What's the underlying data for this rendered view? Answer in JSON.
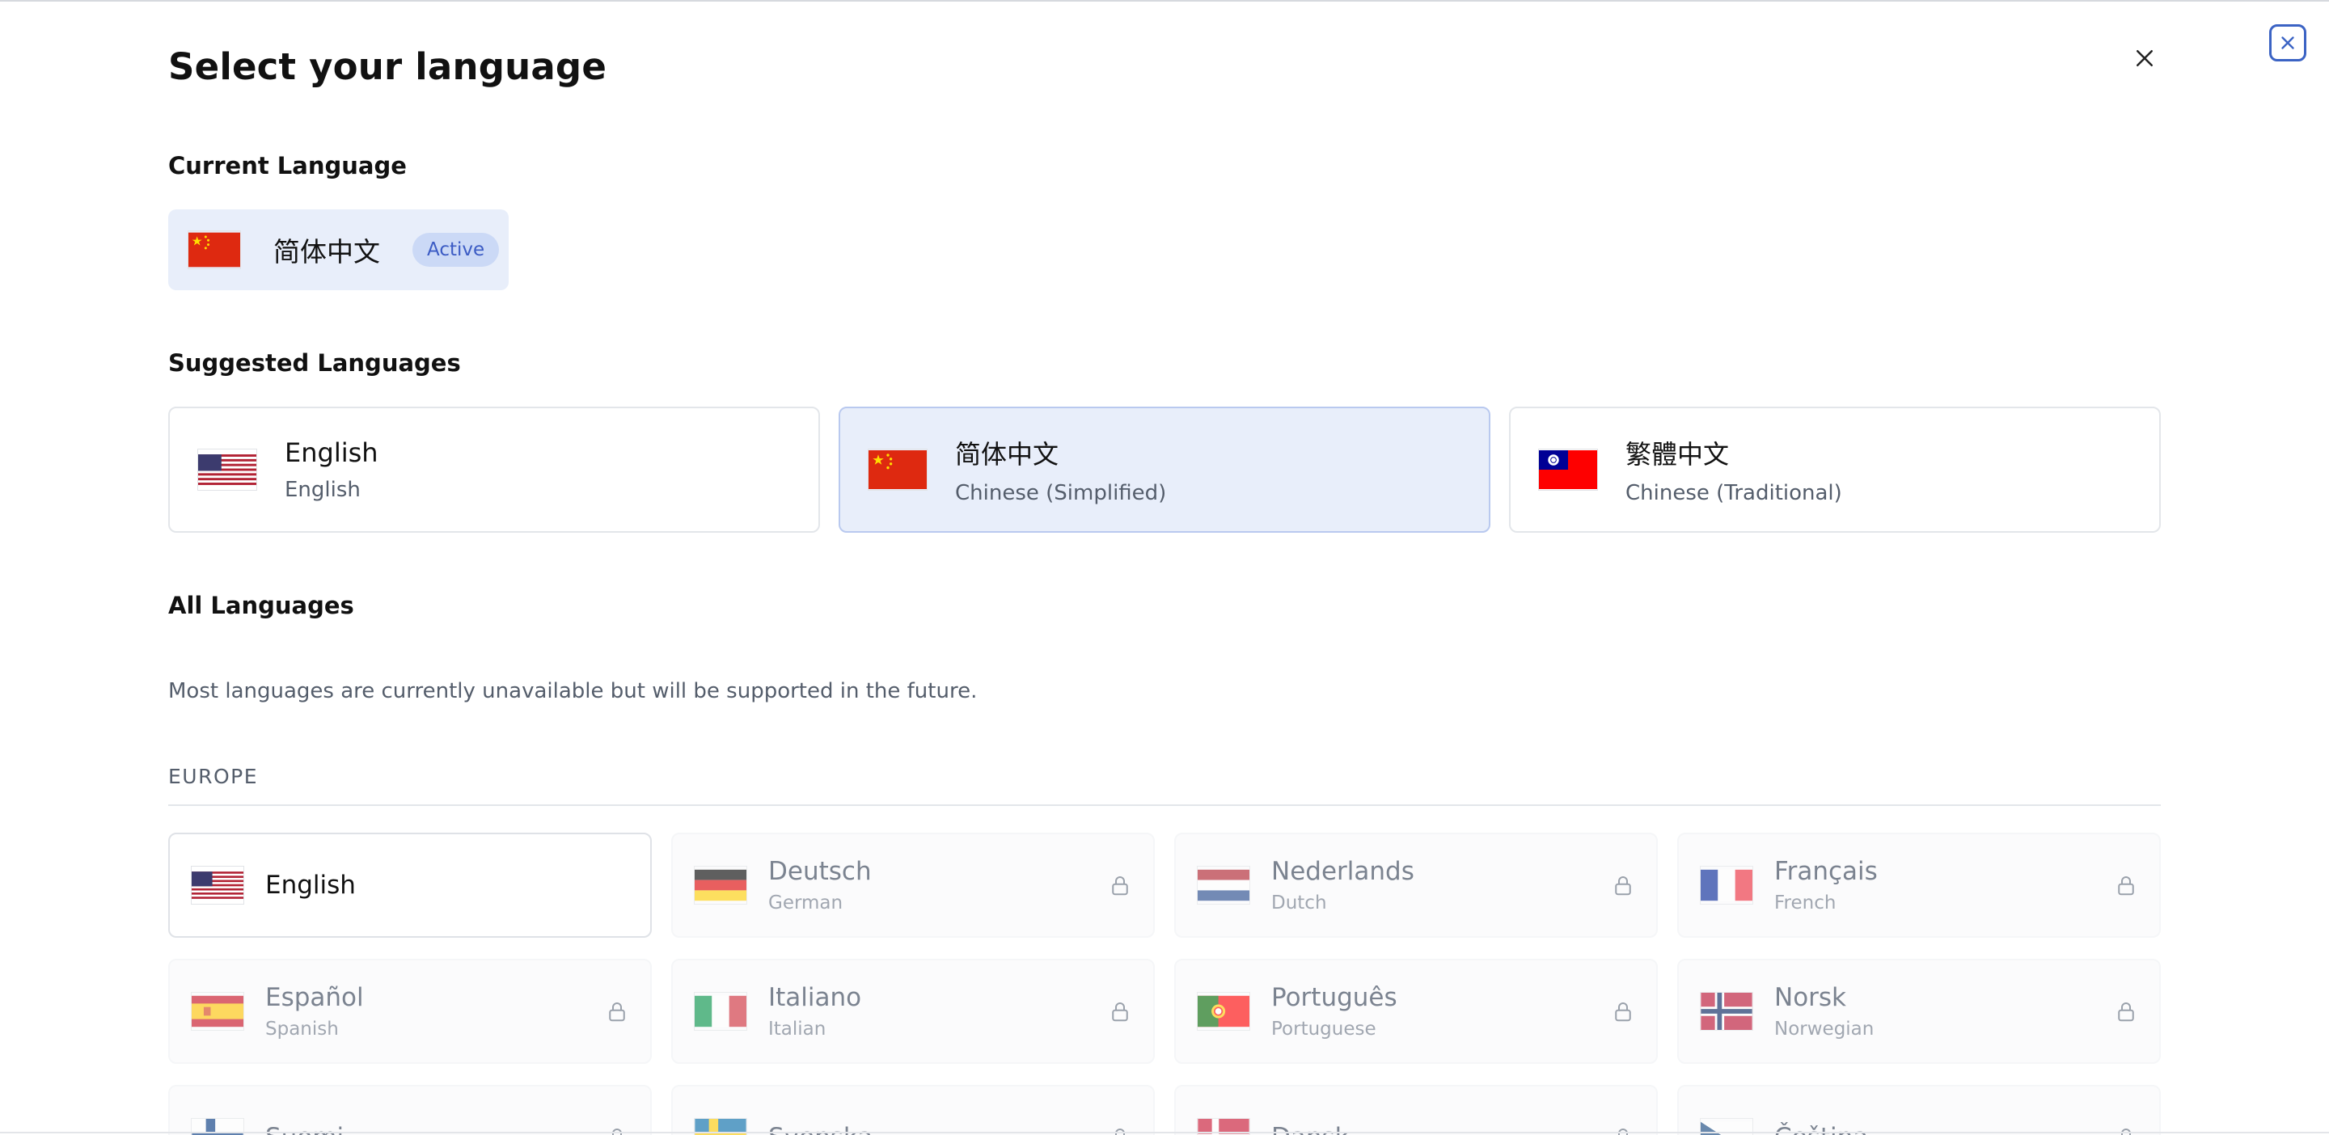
{
  "dialog": {
    "title": "Select your language",
    "current_label": "Current Language",
    "suggested_label": "Suggested Languages",
    "all_label": "All Languages",
    "availability_note": "Most languages are currently unavailable but will be supported in the future."
  },
  "current_language": {
    "native": "简体中文",
    "badge": "Active",
    "flag": "cn-flag"
  },
  "suggested": [
    {
      "native": "English",
      "english": "English",
      "flag": "us-flag",
      "selected": false
    },
    {
      "native": "简体中文",
      "english": "Chinese (Simplified)",
      "flag": "cn-flag",
      "selected": true
    },
    {
      "native": "繁體中文",
      "english": "Chinese (Traditional)",
      "flag": "tw-flag",
      "selected": false
    }
  ],
  "regions": [
    {
      "name": "EUROPE",
      "languages": [
        {
          "native": "English",
          "english": "",
          "flag": "us-flag",
          "available": true
        },
        {
          "native": "Deutsch",
          "english": "German",
          "flag": "de-flag",
          "available": false
        },
        {
          "native": "Nederlands",
          "english": "Dutch",
          "flag": "nl-flag",
          "available": false
        },
        {
          "native": "Français",
          "english": "French",
          "flag": "fr-flag",
          "available": false
        },
        {
          "native": "Español",
          "english": "Spanish",
          "flag": "es-flag",
          "available": false
        },
        {
          "native": "Italiano",
          "english": "Italian",
          "flag": "it-flag",
          "available": false
        },
        {
          "native": "Português",
          "english": "Portuguese",
          "flag": "pt-flag",
          "available": false
        },
        {
          "native": "Norsk",
          "english": "Norwegian",
          "flag": "no-flag",
          "available": false
        },
        {
          "native": "Suomi",
          "english": "",
          "flag": "fi-flag",
          "available": false
        },
        {
          "native": "Svenska",
          "english": "",
          "flag": "se-flag",
          "available": false
        },
        {
          "native": "Dansk",
          "english": "",
          "flag": "dk-flag",
          "available": false
        },
        {
          "native": "Čeština",
          "english": "",
          "flag": "cz-flag",
          "available": false
        }
      ]
    }
  ],
  "colors": {
    "accent": "#3b63c4",
    "selected_bg": "#e8eefa",
    "badge_bg": "#cbd9f6",
    "muted_text": "#545d6b"
  }
}
